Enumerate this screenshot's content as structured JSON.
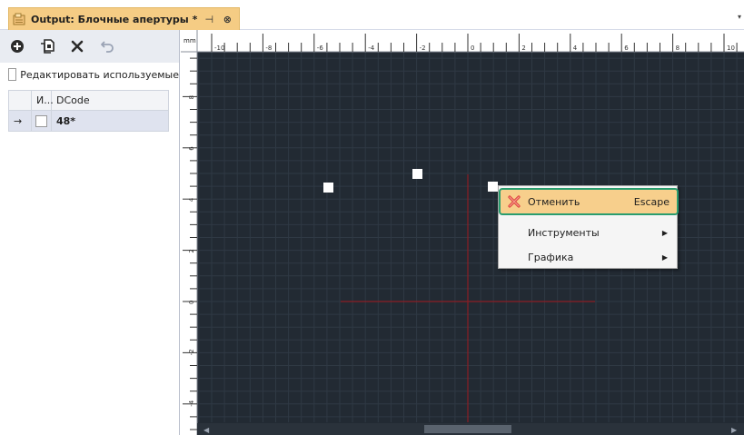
{
  "tab": {
    "title": "Output: Блочные апертуры *",
    "pin_glyph": "⊣",
    "close_glyph": "⊗",
    "menu_glyph": "▾"
  },
  "toolbar": {
    "icons": [
      "add-icon",
      "copy-icon",
      "delete-icon",
      "undo-icon"
    ]
  },
  "edit_used": {
    "label": "Редактировать используемые",
    "checked": false
  },
  "grid": {
    "headers": [
      "",
      "И...",
      "DCode"
    ],
    "rows": [
      {
        "arrow": "→",
        "used": false,
        "dcode": "48*"
      }
    ]
  },
  "ruler": {
    "unit": "mm",
    "x_labels": [
      "-10",
      "-8",
      "-6",
      "-4",
      "-2",
      "0",
      "2",
      "4",
      "6",
      "8",
      "10"
    ],
    "y_labels": [
      "8",
      "6",
      "4",
      "2",
      "0",
      "-2",
      "-4"
    ]
  },
  "context_menu": {
    "items": [
      {
        "label": "Отменить",
        "shortcut": "Escape",
        "icon": "cancel-x-icon",
        "submenu": false
      },
      {
        "label": "Инструменты",
        "shortcut": "",
        "submenu": true
      },
      {
        "label": "Графика",
        "shortcut": "",
        "submenu": true
      }
    ]
  },
  "colors": {
    "canvas_bg": "#222a33",
    "grid_line": "#2f3944",
    "crosshair": "#8b1e24",
    "tab_active": "#f5cc84",
    "menu_highlight": "#f7cf8c",
    "focus_ring": "#2a9d6f"
  }
}
